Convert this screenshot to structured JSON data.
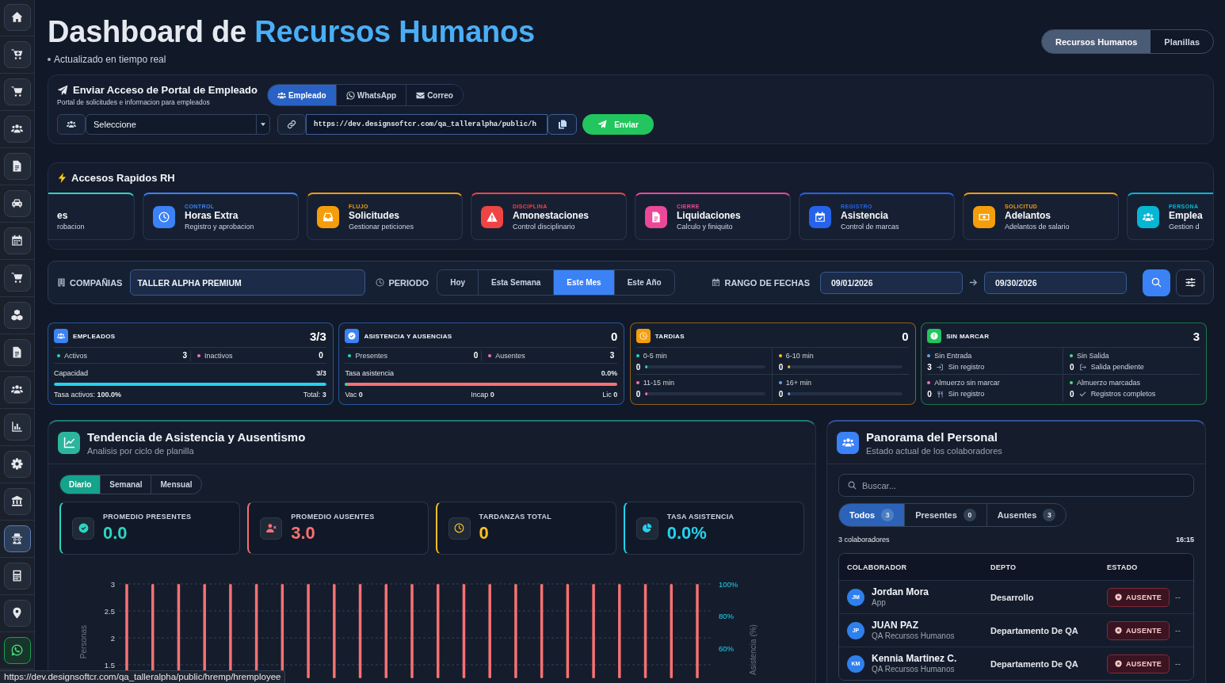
{
  "sidebar": {
    "items": [
      {
        "selected": false
      },
      {
        "selected": false
      },
      {
        "selected": false
      },
      {
        "selected": false
      },
      {
        "selected": false
      },
      {
        "selected": false
      },
      {
        "selected": false
      },
      {
        "selected": false
      },
      {
        "selected": false
      },
      {
        "selected": false
      },
      {
        "selected": false
      },
      {
        "selected": false
      },
      {
        "selected": false
      },
      {
        "selected": false
      },
      {
        "selected": true
      },
      {
        "selected": false
      },
      {
        "selected": false
      },
      {
        "selected": false
      }
    ]
  },
  "header": {
    "title": "Dashboard de",
    "title_highlight": "Recursos Humanos",
    "subtitle": "Actualizado en tiempo real",
    "modules": [
      {
        "label": "Recursos Humanos",
        "selected": true
      },
      {
        "label": "Planillas",
        "selected": false
      }
    ]
  },
  "portal": {
    "title": "Enviar Acceso de Portal de Empleado",
    "subtitle": "Portal de solicitudes e informacion para empleados",
    "channels": [
      {
        "label": "Empleado",
        "selected": true
      },
      {
        "label": "WhatsApp",
        "selected": false
      },
      {
        "label": "Correo",
        "selected": false
      }
    ],
    "employee_select": {
      "value": "Seleccione"
    },
    "url": "https://dev.designsoftcr.com/qa_talleralpha/public/h",
    "send_label": "Enviar"
  },
  "quick_access": {
    "title": "Accesos Rapidos RH",
    "cards": [
      {
        "kind": "clipped_left",
        "title": "es",
        "subtitle": "robacion",
        "color": "#2dd4bf"
      },
      {
        "kind": "card",
        "category": "CONTROL",
        "title": "Horas Extra",
        "subtitle": "Registro y aprobacion",
        "color": "#3b82f6"
      },
      {
        "kind": "card",
        "category": "FLUJO",
        "title": "Solicitudes",
        "subtitle": "Gestionar peticiones",
        "color": "#f59e0b"
      },
      {
        "kind": "card",
        "category": "DISCIPLINA",
        "title": "Amonestaciones",
        "subtitle": "Control disciplinario",
        "color": "#ef4444"
      },
      {
        "kind": "card",
        "category": "CIERRE",
        "title": "Liquidaciones",
        "subtitle": "Calculo y finiquito",
        "color": "#ec4899"
      },
      {
        "kind": "card",
        "category": "REGISTRO",
        "title": "Asistencia",
        "subtitle": "Control de marcas",
        "color": "#2563eb"
      },
      {
        "kind": "card",
        "category": "SOLICITUD",
        "title": "Adelantos",
        "subtitle": "Adelantos de salario",
        "color": "#f59e0b"
      },
      {
        "kind": "clipped_right",
        "category": "PERSONA",
        "title": "Emplea",
        "subtitle": "Gestion d",
        "color": "#06b6d4"
      }
    ]
  },
  "filters": {
    "company": {
      "label": "COMPAÑIAS",
      "value": "TALLER ALPHA PREMIUM"
    },
    "period": {
      "label": "PERIODO",
      "options": [
        {
          "label": "Hoy",
          "selected": false
        },
        {
          "label": "Esta Semana",
          "selected": false
        },
        {
          "label": "Este Mes",
          "selected": true
        },
        {
          "label": "Este Año",
          "selected": false
        }
      ]
    },
    "date_range": {
      "label": "RANGO DE FECHAS",
      "from": "09/01/2026",
      "to": "09/30/2026"
    }
  },
  "stats": [
    {
      "kind": "summary",
      "title": "EMPLEADOS",
      "total": "3/3",
      "color": "#3b82f6",
      "pairs": [
        {
          "label": "Activos",
          "value": "3",
          "color": "#2dd4bf"
        },
        {
          "label": "Inactivos",
          "value": "0",
          "color": "#f472b6"
        }
      ],
      "meter": {
        "kind": "capacity",
        "label": "Capacidad",
        "reading": "3/3",
        "level": 1
      },
      "footer": [
        "Tasa activos: **100.0%**",
        "Total: **3**"
      ]
    },
    {
      "kind": "summary",
      "title": "ASISTENCIA Y AUSENCIAS",
      "total": "0",
      "color": "#3b82f6",
      "pairs": [
        {
          "label": "Presentes",
          "value": "0",
          "color": "#2dd4bf"
        },
        {
          "label": "Ausentes",
          "value": "3",
          "color": "#f472b6"
        }
      ],
      "meter": {
        "kind": "attendance",
        "label": "Tasa asistencia",
        "reading": "0.0%",
        "level": 0
      },
      "footer": [
        "Vac **0**",
        "Incap **0**",
        "Lic **0**"
      ]
    },
    {
      "kind": "buckets",
      "title": "TARDIAS",
      "total": "0",
      "color": "#f59e0b",
      "cells": [
        {
          "label": "0-5 min",
          "value": "0",
          "level": 0,
          "color": "#2dd4bf"
        },
        {
          "label": "6-10 min",
          "value": "0",
          "level": 0,
          "color": "#fbbf24"
        },
        {
          "label": "11-15 min",
          "value": "0",
          "level": 0,
          "color": "#f472b6"
        },
        {
          "label": "16+ min",
          "value": "0",
          "level": 0,
          "color": "#60a5fa"
        }
      ]
    },
    {
      "kind": "marks",
      "title": "SIN MARCAR",
      "total": "3",
      "color": "#22c55e",
      "cells": [
        {
          "label": "Sin Entrada",
          "value": "3",
          "note": "Sin registro",
          "color": "#60a5fa"
        },
        {
          "label": "Sin Salida",
          "value": "0",
          "note": "Salida pendiente",
          "color": "#4ade80"
        },
        {
          "label": "Almuerzo sin marcar",
          "value": "0",
          "note": "Sin registro",
          "color": "#f472b6"
        },
        {
          "label": "Almuerzo marcadas",
          "value": "0",
          "note": "Registros completos",
          "color": "#4ade80"
        }
      ]
    }
  ],
  "attendance_panel": {
    "title": "Tendencia de Asistencia y Ausentismo",
    "subtitle": "Analisis por ciclo de planilla",
    "ranges": [
      {
        "label": "Diario",
        "selected": true
      },
      {
        "label": "Semanal",
        "selected": false
      },
      {
        "label": "Mensual",
        "selected": false
      }
    ],
    "kpis": [
      {
        "label": "PROMEDIO PRESENTES",
        "value": "0.0",
        "color": "#2dd4bf"
      },
      {
        "label": "PROMEDIO AUSENTES",
        "value": "3.0",
        "color": "#f87171"
      },
      {
        "label": "TARDANZAS TOTAL",
        "value": "0",
        "color": "#fbbf24"
      },
      {
        "label": "TASA ASISTENCIA",
        "value": "0.0%",
        "color": "#22d3ee"
      }
    ],
    "chart_data": {
      "type": "bar",
      "ylabel": "Personas",
      "ylim": [
        1.25,
        3
      ],
      "yticks": [
        1.5,
        2,
        2.5,
        3
      ],
      "grid": true,
      "values": [
        3,
        3,
        3,
        3,
        3,
        3,
        3,
        3,
        3,
        3,
        3,
        3,
        3,
        3,
        3,
        3,
        3,
        3,
        3,
        3,
        3,
        3,
        3
      ]
    },
    "right_axis": {
      "label": "Asistencia (%)",
      "ticks": [
        "100%",
        "80%",
        "60%"
      ]
    }
  },
  "staff_panel": {
    "title": "Panorama del Personal",
    "subtitle": "Estado actual de los colaboradores",
    "search": {
      "placeholder": "Buscar..."
    },
    "filters": [
      {
        "label": "Todos",
        "count": "3",
        "selected": true
      },
      {
        "label": "Presentes",
        "count": "0",
        "selected": false
      },
      {
        "label": "Ausentes",
        "count": "3",
        "selected": false
      }
    ],
    "summary": "3 colaboradores",
    "time": "16:15",
    "columns": [
      "COLABORADOR",
      "DEPTO",
      "ESTADO"
    ],
    "rows": [
      {
        "initials": "JM",
        "name": "Jordan Mora",
        "role": "App",
        "department": "Desarrollo",
        "status": {
          "label": "AUSENTE",
          "kind": "absent"
        },
        "extra": "--"
      },
      {
        "initials": "JP",
        "name": "JUAN PAZ",
        "role": "QA Recursos Humanos",
        "department": "Departamento De QA",
        "status": {
          "label": "AUSENTE",
          "kind": "absent"
        },
        "extra": "--"
      },
      {
        "initials": "KM",
        "name": "Kennia Martinez C.",
        "role": "QA Recursos Humanos",
        "department": "Departamento De QA",
        "status": {
          "label": "AUSENTE",
          "kind": "absent"
        },
        "extra": "--"
      }
    ]
  },
  "link_preview": "https://dev.designsoftcr.com/qa_talleralpha/public/hremp/hremployee"
}
